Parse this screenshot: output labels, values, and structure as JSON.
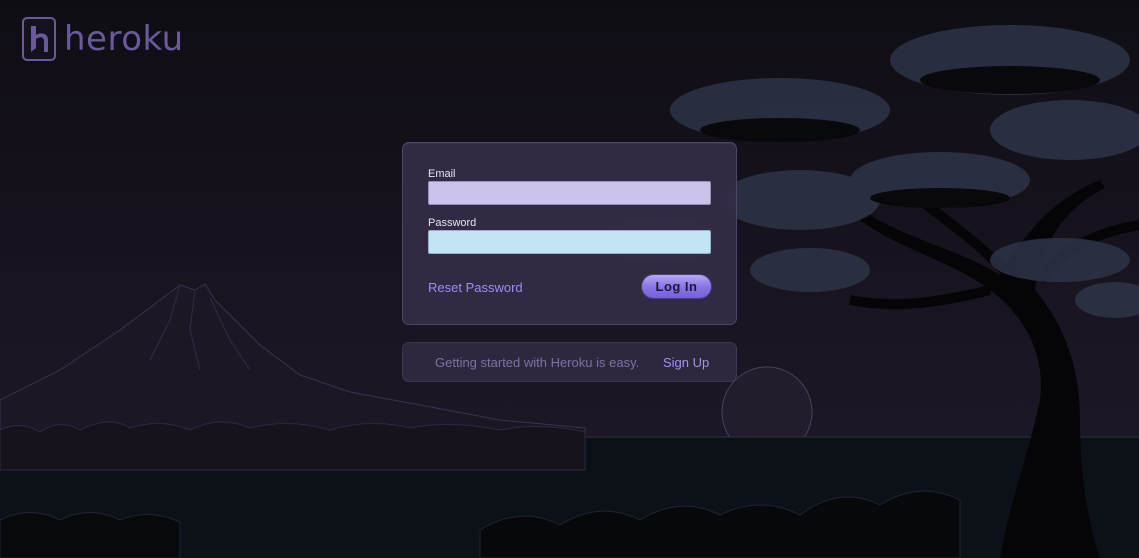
{
  "brand": {
    "name": "heroku",
    "logo_icon": "heroku-logo-icon",
    "color": "#6a5a9b"
  },
  "login": {
    "email_label": "Email",
    "email_value": "",
    "password_label": "Password",
    "password_value": "",
    "reset_label": "Reset Password",
    "login_button_label": "Log In"
  },
  "signup": {
    "prompt": "Getting started with Heroku is easy.",
    "link_label": "Sign Up"
  },
  "colors": {
    "accent": "#9d8ff0",
    "email_field_bg": "#cdc3ea",
    "password_field_bg": "#c3e4f5",
    "panel_bg": "#342c46"
  }
}
